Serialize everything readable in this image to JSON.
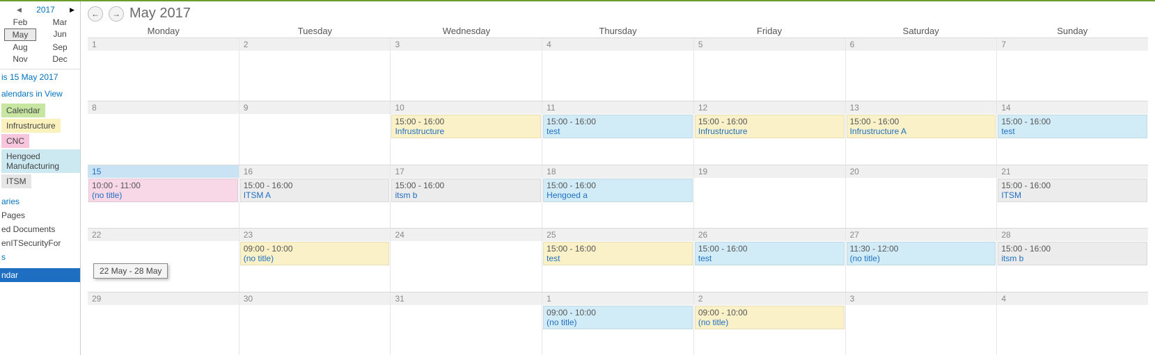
{
  "side": {
    "year": "2017",
    "months": [
      [
        "Feb",
        "Mar"
      ],
      [
        "May",
        "Jun"
      ],
      [
        "Aug",
        "Sep"
      ],
      [
        "Nov",
        "Dec"
      ]
    ],
    "selected_month": "May",
    "today_label": "is 15 May 2017",
    "calendars_header": "alendars in View",
    "calendars": [
      {
        "label": "Calendar",
        "color": "green"
      },
      {
        "label": "Infrustructure",
        "color": "yellow"
      },
      {
        "label": "CNC",
        "color": "pink"
      },
      {
        "label": "Hengoed Manufacturing",
        "color": "blue"
      },
      {
        "label": "ITSM",
        "color": "gray"
      }
    ],
    "links": {
      "aries": "aries",
      "pages": "Pages",
      "docs": "ed Documents",
      "sec": "enITSecurityFor",
      "s": "s",
      "ndar": "ndar"
    }
  },
  "header": {
    "title": "May 2017"
  },
  "dow": [
    "Monday",
    "Tuesday",
    "Wednesday",
    "Thursday",
    "Friday",
    "Saturday",
    "Sunday"
  ],
  "weeks": [
    {
      "days": [
        {
          "n": "1"
        },
        {
          "n": "2"
        },
        {
          "n": "3"
        },
        {
          "n": "4"
        },
        {
          "n": "5"
        },
        {
          "n": "6"
        },
        {
          "n": "7"
        }
      ]
    },
    {
      "days": [
        {
          "n": "8"
        },
        {
          "n": "9"
        },
        {
          "n": "10",
          "ev": [
            {
              "t": "15:00 - 16:00",
              "n": "Infrustructure",
              "c": "yellow"
            }
          ]
        },
        {
          "n": "11",
          "ev": [
            {
              "t": "15:00 - 16:00",
              "n": "test",
              "c": "blue"
            }
          ]
        },
        {
          "n": "12",
          "ev": [
            {
              "t": "15:00 - 16:00",
              "n": "Infrustructure",
              "c": "yellow"
            }
          ]
        },
        {
          "n": "13",
          "ev": [
            {
              "t": "15:00 - 16:00",
              "n": "Infrustructure A",
              "c": "yellow"
            }
          ]
        },
        {
          "n": "14",
          "ev": [
            {
              "t": "15:00 - 16:00",
              "n": "test",
              "c": "blue"
            }
          ]
        }
      ]
    },
    {
      "days": [
        {
          "n": "15",
          "today": true,
          "ev": [
            {
              "t": "10:00 - 11:00",
              "n": "(no title)",
              "c": "pink"
            }
          ]
        },
        {
          "n": "16",
          "ev": [
            {
              "t": "15:00 - 16:00",
              "n": "ITSM A",
              "c": "gray"
            }
          ]
        },
        {
          "n": "17",
          "ev": [
            {
              "t": "15:00 - 16:00",
              "n": "itsm b",
              "c": "gray"
            }
          ]
        },
        {
          "n": "18",
          "ev": [
            {
              "t": "15:00 - 16:00",
              "n": "Hengoed a",
              "c": "blue"
            }
          ]
        },
        {
          "n": "19"
        },
        {
          "n": "20"
        },
        {
          "n": "21",
          "ev": [
            {
              "t": "15:00 - 16:00",
              "n": "ITSM",
              "c": "gray"
            }
          ]
        }
      ]
    },
    {
      "days": [
        {
          "n": "22"
        },
        {
          "n": "23",
          "ev": [
            {
              "t": "09:00 - 10:00",
              "n": "(no title)",
              "c": "yellow"
            }
          ]
        },
        {
          "n": "24"
        },
        {
          "n": "25",
          "ev": [
            {
              "t": "15:00 - 16:00",
              "n": "test",
              "c": "yellow"
            }
          ]
        },
        {
          "n": "26",
          "ev": [
            {
              "t": "15:00 - 16:00",
              "n": "test",
              "c": "blue"
            }
          ]
        },
        {
          "n": "27",
          "ev": [
            {
              "t": "11:30 - 12:00",
              "n": "(no title)",
              "c": "blue"
            }
          ]
        },
        {
          "n": "28",
          "ev": [
            {
              "t": "15:00 - 16:00",
              "n": "itsm b",
              "c": "gray"
            }
          ]
        }
      ]
    },
    {
      "days": [
        {
          "n": "29"
        },
        {
          "n": "30"
        },
        {
          "n": "31"
        },
        {
          "n": "1",
          "ev": [
            {
              "t": "09:00 - 10:00",
              "n": "(no title)",
              "c": "blue"
            }
          ]
        },
        {
          "n": "2",
          "ev": [
            {
              "t": "09:00 - 10:00",
              "n": "(no title)",
              "c": "yellow"
            }
          ]
        },
        {
          "n": "3"
        },
        {
          "n": "4"
        }
      ]
    }
  ],
  "tooltip": "22 May - 28 May"
}
